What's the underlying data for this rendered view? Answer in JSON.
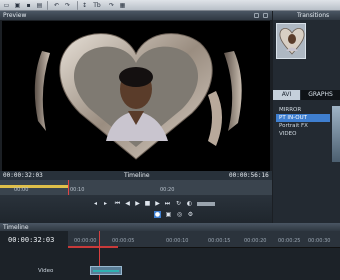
{
  "preview": {
    "title": "Preview",
    "timecode_current": "00:00:32:03",
    "timecode_end": "00:00:56:16",
    "timeline_label": "Timeline",
    "ruler_marks": [
      "00:00",
      "00:10",
      "00:20"
    ]
  },
  "transitions": {
    "title": "Transitions",
    "tabs": [
      "AVI",
      "GRAPHS"
    ],
    "items": [
      "MIRROR",
      "PT IN-OUT",
      "Portrait FX",
      "VIDEO"
    ],
    "selected_index": 1
  },
  "timeline": {
    "title": "Timeline",
    "timecode": "00:00:32:03",
    "ruler_marks": [
      "00:00:00",
      "00:00:05",
      "00:00:10",
      "00:00:15",
      "00:00:20",
      "00:00:25",
      "00:00:30"
    ],
    "track_label": "Video"
  },
  "colors": {
    "accent": "#3f7fd0",
    "playhead": "#e04545",
    "played": "#e0c04a"
  }
}
